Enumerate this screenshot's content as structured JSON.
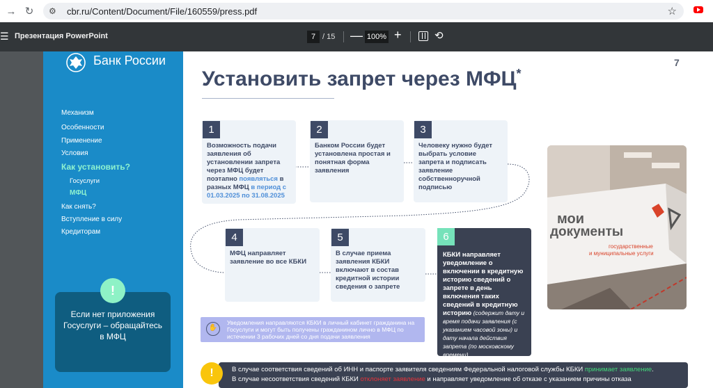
{
  "browser": {
    "url": "cbr.ru/Content/Document/File/160559/press.pdf",
    "back_icon": "arrow-right-icon",
    "reload_icon": "reload-icon"
  },
  "pdf_toolbar": {
    "title": "Презентация PowerPoint",
    "current_page": "7",
    "total_pages": "/ 15",
    "zoom": "100%",
    "zoom_out": "—",
    "zoom_in": "+"
  },
  "slide": {
    "page_number": "7",
    "logo_text": "Банк России",
    "title": "Установить запрет через МФЦ",
    "title_mark": "*",
    "menu": [
      "Механизм",
      "Особенности",
      "Применение",
      "Условия",
      "Как установить?",
      "Госуслуги",
      "МФЦ",
      "Как снять?",
      "Вступление в силу",
      "Кредиторам"
    ],
    "info_badge": "!",
    "info_card_text": "Если нет приложения Госуслуги – обращайтесь в МФЦ",
    "steps": [
      {
        "num": "1",
        "text_a": "Возможность подачи заявления об установлении запрета через МФЦ будет поэтапно ",
        "text_hl1": "появляться",
        "text_b": " в разных МФЦ ",
        "text_hl2": "в период с 01.03.2025 по 31.08.2025"
      },
      {
        "num": "2",
        "text": "Банком России будет установлена простая и понятная форма заявления"
      },
      {
        "num": "3",
        "text": "Человеку нужно будет выбрать условие запрета и подписать заявление собственноручной подписью"
      },
      {
        "num": "4",
        "text": "МФЦ направляет заявление во все КБКИ"
      },
      {
        "num": "5",
        "text": "В случае приема заявления КБКИ включают в состав кредитной истории сведения о запрете"
      },
      {
        "num": "6",
        "text": "КБКИ направляет уведомление о включении в кредитную историю сведений о запрете в день включения таких сведений в кредитную историю",
        "text_italic": " (содержит дату и время подачи заявления (с указанием часовой зоны) и дату начала действия запрета (по московскому времени)"
      }
    ],
    "notice_text": "Уведомления направляются КБКИ в личный кабинет гражданина на Госуслуги и могут быть получены гражданином лично в МФЦ по истечении 3 рабочих дней со дня подачи заявления",
    "notice_icon": "hands-icon",
    "warn_badge": "!",
    "banner_line1_a": "В случае соответствия сведений об ИНН и паспорте заявителя сведениям Федеральной налоговой службы КБКИ ",
    "banner_line1_g": "принимает заявление",
    "banner_line1_b": ".",
    "banner_line2_a": "В случае несоответствия сведений КБКИ ",
    "banner_line2_r": "отклоняет заявление",
    "banner_line2_b": " и направляет уведомление об отказе с указанием причины отказа",
    "photo_sign_line1": "мои",
    "photo_sign_line2": "документы",
    "photo_sign_line3": "государственные",
    "photo_sign_line4": "и муниципальные услуги",
    "colors": {
      "sidebar": "#1a8bc8",
      "accent_mint": "#8ef2d0",
      "title": "#3e4a66",
      "highlight": "#4f8fd8",
      "accept_green": "#43d97a",
      "reject_red": "#e5333a",
      "warn_yellow": "#f9c50c"
    }
  }
}
